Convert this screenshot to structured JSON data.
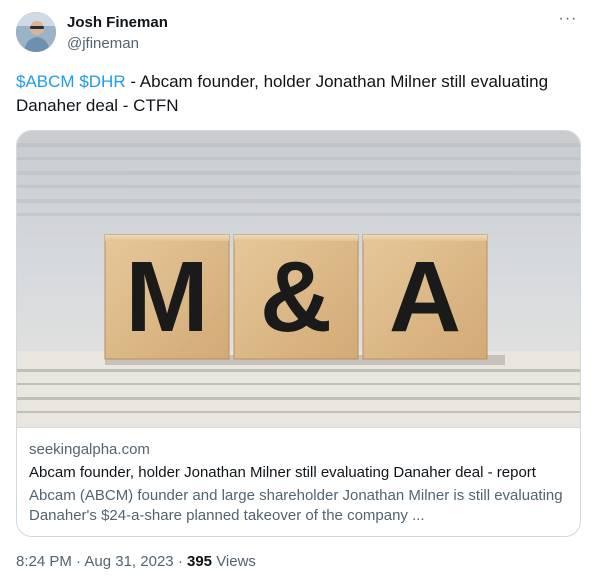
{
  "author": {
    "name": "Josh Fineman",
    "handle": "@jfineman"
  },
  "menu": {
    "more_icon": "more-horizontal-icon",
    "more_label": "···"
  },
  "tweet": {
    "cashtag_1": "$ABCM",
    "cashtag_2": "$DHR",
    "text": "- Abcam founder, holder Jonathan Milner still evaluating Danaher deal -  CTFN"
  },
  "card": {
    "image_letters": [
      "M",
      "&",
      "A"
    ],
    "domain": "seekingalpha.com",
    "title": "Abcam founder, holder Jonathan Milner still evaluating Danaher deal - report",
    "description": "Abcam (ABCM) founder and large shareholder Jonathan Milner is still evaluating Danaher's $24-a-share planned takeover of the company ..."
  },
  "footer": {
    "time": "8:24 PM",
    "separator": "·",
    "date": "Aug 31, 2023",
    "views_count": "395",
    "views_label": "Views"
  },
  "colors": {
    "link": "#1d9bf0",
    "text": "#0f1419",
    "secondary": "#536471",
    "border": "#cfd9de"
  }
}
